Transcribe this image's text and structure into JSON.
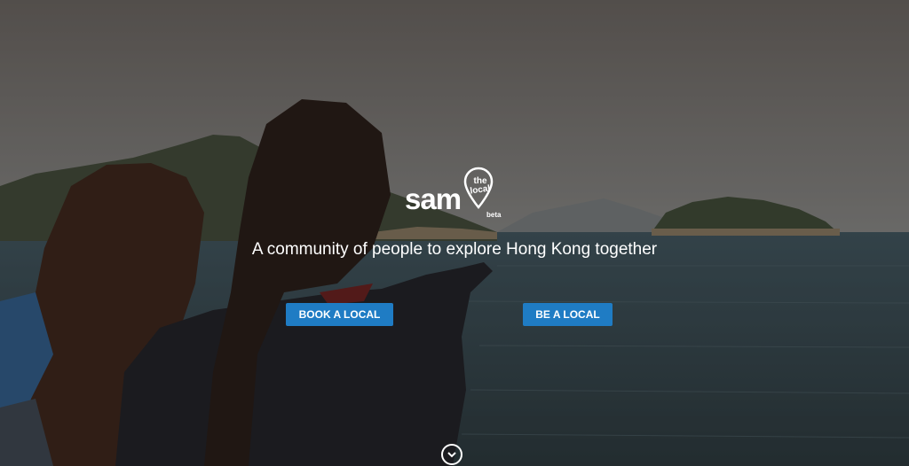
{
  "hero": {
    "background_image": "harbor-scene-two-people-pointing-at-sea",
    "colors": {
      "button_bg": "#1f7cc4",
      "text": "#ffffff"
    }
  },
  "logo": {
    "wordmark": "sam",
    "pin_top": "the",
    "pin_bottom": "local",
    "badge": "beta"
  },
  "tagline": "A community of people to explore Hong Kong together",
  "buttons": {
    "book": "BOOK A LOCAL",
    "be": "BE A LOCAL"
  },
  "scroll_icon": "chevron-down-icon"
}
